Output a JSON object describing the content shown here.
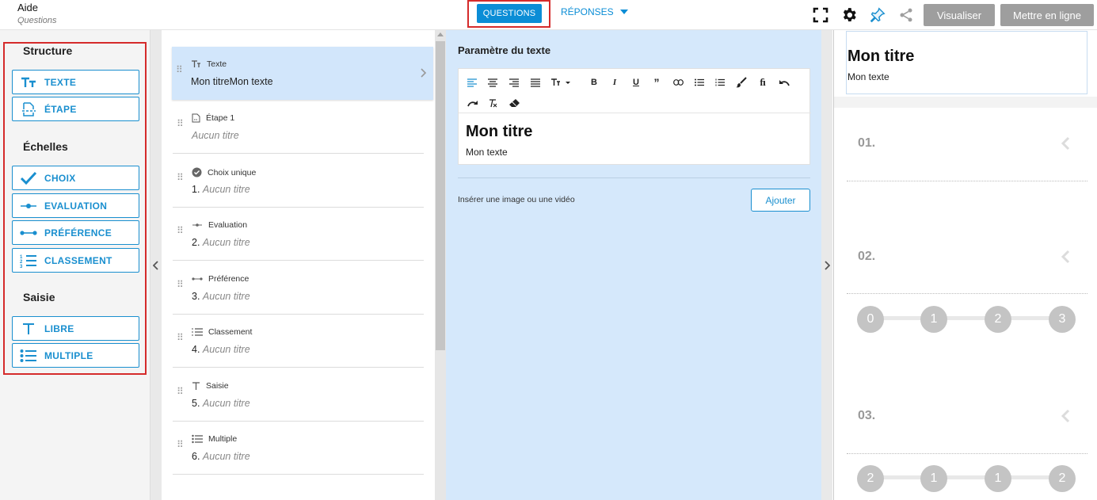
{
  "header": {
    "title": "Aide",
    "subtitle": "Questions",
    "nav": {
      "questions": "QUESTIONS",
      "responses": "RÉPONSES"
    },
    "icons": [
      "fullscreen-icon",
      "gear-icon",
      "pin-icon",
      "share-icon"
    ],
    "buttons": {
      "preview": "Visualiser",
      "publish": "Mettre en ligne"
    }
  },
  "sidebar": {
    "sections": [
      {
        "title": "Structure",
        "items": [
          {
            "label": "TEXTE",
            "icon": "text-size-icon"
          },
          {
            "label": "ÉTAPE",
            "icon": "page-break-icon"
          }
        ]
      },
      {
        "title": "Échelles",
        "items": [
          {
            "label": "CHOIX",
            "icon": "check-icon"
          },
          {
            "label": "EVALUATION",
            "icon": "slider-icon"
          },
          {
            "label": "PRÉFÉRENCE",
            "icon": "range-icon"
          },
          {
            "label": "CLASSEMENT",
            "icon": "ordered-list-icon"
          }
        ]
      },
      {
        "title": "Saisie",
        "items": [
          {
            "label": "LIBRE",
            "icon": "text-icon"
          },
          {
            "label": "MULTIPLE",
            "icon": "list-icon"
          }
        ]
      }
    ]
  },
  "questions": [
    {
      "kind": "Texte",
      "number": "",
      "title": "Mon titreMon texte",
      "empty": false,
      "icon": "text-size-icon"
    },
    {
      "kind": "Étape 1",
      "number": "",
      "title": "Aucun titre",
      "empty": true,
      "icon": "page-break-icon"
    },
    {
      "kind": "Choix unique",
      "number": "1.",
      "title": "Aucun titre",
      "empty": true,
      "icon": "check-circle-icon"
    },
    {
      "kind": "Evaluation",
      "number": "2.",
      "title": "Aucun titre",
      "empty": true,
      "icon": "slider-icon"
    },
    {
      "kind": "Préférence",
      "number": "3.",
      "title": "Aucun titre",
      "empty": true,
      "icon": "range-icon"
    },
    {
      "kind": "Classement",
      "number": "4.",
      "title": "Aucun titre",
      "empty": true,
      "icon": "ordered-list-icon"
    },
    {
      "kind": "Saisie",
      "number": "5.",
      "title": "Aucun titre",
      "empty": true,
      "icon": "text-icon"
    },
    {
      "kind": "Multiple",
      "number": "6.",
      "title": "Aucun titre",
      "empty": true,
      "icon": "list-icon"
    }
  ],
  "editor": {
    "label": "Paramètre du texte",
    "content_title": "Mon titre",
    "content_text": "Mon texte",
    "media_label": "Insérer une image ou une vidéo",
    "add_button": "Ajouter"
  },
  "preview": {
    "title": "Mon titre",
    "text": "Mon texte",
    "questions": [
      {
        "number": "01.",
        "scale": []
      },
      {
        "number": "02.",
        "scale": [
          "0",
          "1",
          "2",
          "3"
        ]
      },
      {
        "number": "03.",
        "scale": [
          "2",
          "1",
          "1",
          "2"
        ]
      }
    ]
  },
  "colors": {
    "accent": "#0b8dd6",
    "selected": "#d2e6fb",
    "highlight": "#d52b2b",
    "grey_button": "#9e9e9e"
  }
}
